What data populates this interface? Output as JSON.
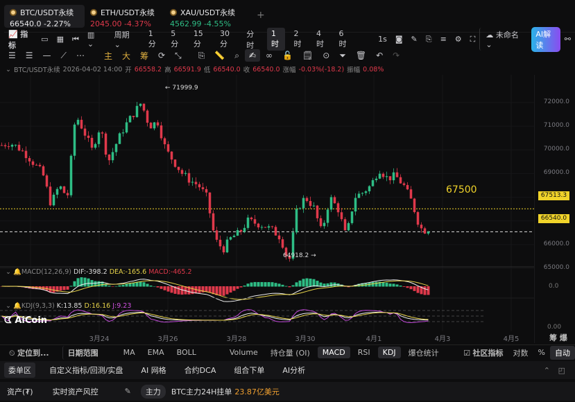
{
  "tabs": [
    {
      "name": "BTC/USDT永续",
      "price": "66540.0",
      "change": "-2.27%",
      "trend": "down",
      "active": true
    },
    {
      "name": "ETH/USDT永续",
      "price": "2045.00",
      "change": "-4.37%",
      "trend": "down"
    },
    {
      "name": "XAU/USDT永续",
      "price": "4562.99",
      "change": "-4.55%",
      "trend": "down"
    }
  ],
  "add_tab": "+",
  "toolbar": {
    "indicator": "指标",
    "period": "周期",
    "periods": [
      "1分",
      "5分",
      "15分",
      "30分",
      "分时",
      "1时",
      "2时",
      "4时",
      "6时"
    ],
    "selected_period": "1时",
    "interval": "1s",
    "layout_name": "未命名",
    "ai_button": "AI解读"
  },
  "draw_toolbar": {
    "labels": [
      "主",
      "大",
      "筹"
    ]
  },
  "info": {
    "symbol": "BTC/USDT永续",
    "time": "2026-04-02 14:00",
    "open_label": "开",
    "open": "66558.2",
    "high_label": "高",
    "high": "66591.9",
    "low_label": "低",
    "low": "66540.0",
    "close_label": "收",
    "close": "66540.0",
    "change_label": "涨幅",
    "change": "-0.03%(-18.2)",
    "amp_label": "振幅",
    "amp": "0.08%"
  },
  "chart": {
    "y_ticks": [
      "72000.0",
      "71000.0",
      "70000.0",
      "69000.0",
      "68000.0",
      "67000.0",
      "66000.0",
      "65000.0"
    ],
    "y_range": [
      64500,
      72500
    ],
    "high_label": "71999.9",
    "low_label": "64918.2",
    "line_label": "67500",
    "line_price": "67513.3",
    "last_price": "66540.0",
    "x_ticks": [
      "3月24",
      "3月26",
      "3月28",
      "3月30",
      "4月1",
      "4月3",
      "4月5"
    ],
    "price_path": [
      70200,
      70300,
      70100,
      69800,
      69400,
      69000,
      67700,
      68500,
      68000,
      71500,
      70800,
      70000,
      71000,
      69500,
      70300,
      71000,
      71500,
      71999,
      71000,
      71200,
      70000,
      69500,
      69000,
      68700,
      68500,
      68000,
      66200,
      65800,
      66300,
      66500,
      67000,
      66900,
      66800,
      66600,
      66300,
      65200,
      67500,
      68000,
      67600,
      66500,
      68000,
      67500,
      66300,
      68000,
      68200,
      68500,
      69200,
      68800,
      68900,
      68500,
      67800,
      66700,
      66540
    ],
    "up_color": "#2ebd85",
    "down_color": "#e0394b",
    "line_color": "#f0d32a"
  },
  "macd": {
    "label": "MACD(12,26,9)",
    "dif": "DIF:-398.2",
    "dea": "DEA:-165.6",
    "macd": "MACD:-465.2",
    "zero": "0.0"
  },
  "kdj": {
    "label": "KDJ(9,3,3)",
    "k": "K:13.85",
    "d": "D:16.16",
    "j": "J:9.23",
    "zero": "0.00"
  },
  "logo": "AiCoin",
  "axis_corner": [
    "筹",
    "爆"
  ],
  "indicator_bar": {
    "locate": "定位到...",
    "date_range": "日期范围",
    "items": [
      "MA",
      "EMA",
      "BOLL",
      "Volume",
      "持仓量 (OI)",
      "MACD",
      "RSI",
      "KDJ",
      "爆仓统计"
    ],
    "selected": [
      "MACD",
      "KDJ"
    ],
    "community": "社区指标",
    "log": "对数",
    "pct": "%",
    "auto": "自动"
  },
  "bottom_tabs": [
    "委单区",
    "自定义指标/回测/实盘",
    "AI 网格",
    "合约DCA",
    "组合下单",
    "AI分析"
  ],
  "status": {
    "assets": "资产(₮)",
    "risk": "实时资产风控",
    "badge": "主力",
    "text": "BTC主力24H挂单",
    "amount": "23.87亿美元"
  }
}
